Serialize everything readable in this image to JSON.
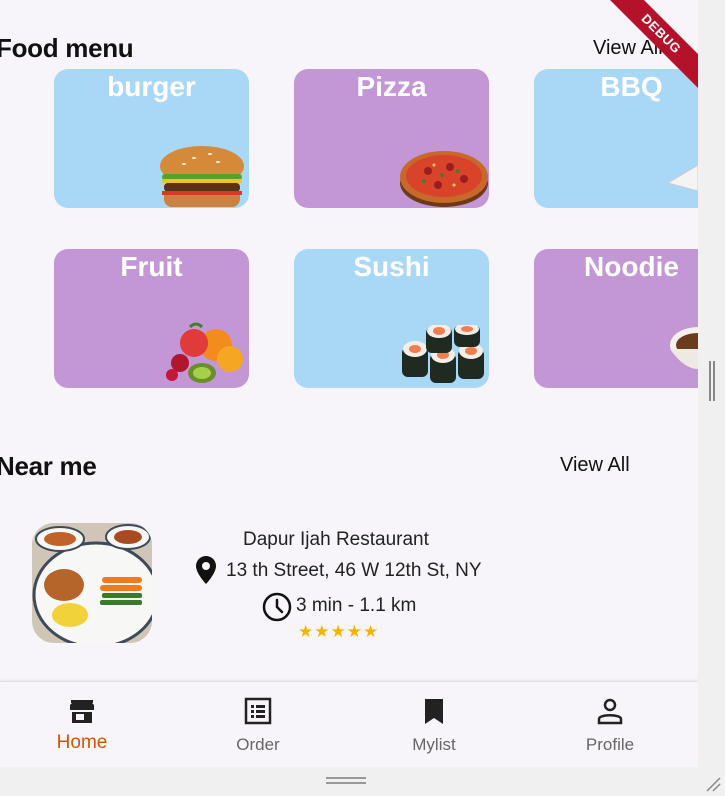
{
  "food_section": {
    "title": "Food menu",
    "view_all": "View All",
    "categories": [
      {
        "label": "burger",
        "color": "blue"
      },
      {
        "label": "Pizza",
        "color": "purple"
      },
      {
        "label": "BBQ",
        "color": "blue"
      },
      {
        "label": "Fruit",
        "color": "purple"
      },
      {
        "label": "Sushi",
        "color": "blue"
      },
      {
        "label": "Noodie",
        "color": "purple"
      }
    ]
  },
  "near_section": {
    "title": "Near me",
    "view_all": "View All",
    "restaurant": {
      "name": "Dapur Ijah Restaurant",
      "address": "13 th Street, 46 W 12th St, NY",
      "time_distance": "3 min - 1.1 km",
      "rating": "★★★★★"
    }
  },
  "debug_banner": "DEBUG",
  "bottom_nav": {
    "items": [
      {
        "label": "Home",
        "icon": "store-icon",
        "active": true
      },
      {
        "label": "Order",
        "icon": "list-icon",
        "active": false
      },
      {
        "label": "Mylist",
        "icon": "bookmark-icon",
        "active": false
      },
      {
        "label": "Profile",
        "icon": "person-icon",
        "active": false
      }
    ]
  },
  "colors": {
    "card_blue": "#a8d8f5",
    "card_purple": "#c396d6",
    "active_nav": "#d35400",
    "star": "#f5b400",
    "debug": "#b3122a"
  }
}
